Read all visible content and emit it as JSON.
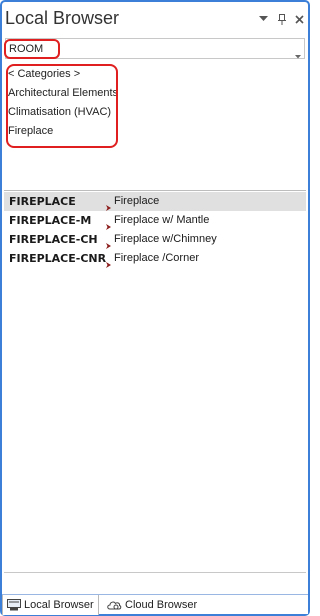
{
  "panel": {
    "title": "Local Browser",
    "controls": [
      "dropdown-arrow",
      "pin",
      "close"
    ]
  },
  "search": {
    "value": "ROOM",
    "placeholder": ""
  },
  "categories": {
    "items": [
      {
        "label": "< Categories >"
      },
      {
        "label": "Architectural Elements"
      },
      {
        "label": "Climatisation (HVAC)"
      },
      {
        "label": "Fireplace"
      }
    ]
  },
  "results": {
    "rows": [
      {
        "code": "FIREPLACE",
        "description": "Fireplace",
        "selected": true
      },
      {
        "code": "FIREPLACE-M",
        "description": "Fireplace w/ Mantle",
        "selected": false
      },
      {
        "code": "FIREPLACE-CH",
        "description": "Fireplace w/Chimney",
        "selected": false
      },
      {
        "code": "FIREPLACE-CNR",
        "description": "Fireplace /Corner",
        "selected": false
      }
    ]
  },
  "tabs": [
    {
      "label": "Local Browser",
      "icon": "local-browser-icon",
      "active": true
    },
    {
      "label": "Cloud Browser",
      "icon": "cloud-browser-icon",
      "active": false
    }
  ],
  "colors": {
    "border_accent": "#3b7fd8",
    "highlight_red": "#e02020",
    "selected_row": "#e0e0e0",
    "chevron": "#8b1a1a"
  }
}
